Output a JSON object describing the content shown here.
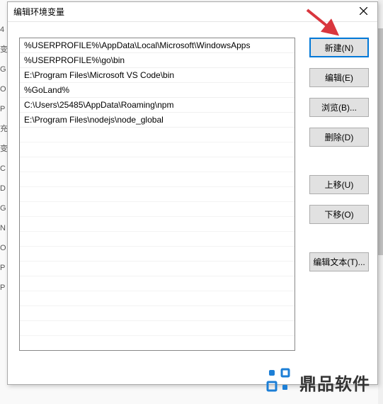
{
  "dialog": {
    "title": "编辑环境变量"
  },
  "list": {
    "items": [
      "%USERPROFILE%\\AppData\\Local\\Microsoft\\WindowsApps",
      "%USERPROFILE%\\go\\bin",
      "E:\\Program Files\\Microsoft VS Code\\bin",
      "%GoLand%",
      "C:\\Users\\25485\\AppData\\Roaming\\npm",
      "E:\\Program Files\\nodejs\\node_global"
    ]
  },
  "buttons": {
    "new": "新建(N)",
    "edit": "编辑(E)",
    "browse": "浏览(B)...",
    "delete": "删除(D)",
    "moveup": "上移(U)",
    "movedown": "下移(O)",
    "edittext": "编辑文本(T)..."
  },
  "bg": {
    "l0": "4",
    "l1": "变",
    "l2": "G",
    "l3": "O",
    "l4": "P",
    "l5": "充",
    "l6": "变",
    "l7": "C",
    "l8": "D",
    "l9": "G",
    "l10": "N",
    "l11": "O",
    "l12": "P",
    "l13": "P"
  },
  "watermark": {
    "text": "鼎品软件"
  }
}
